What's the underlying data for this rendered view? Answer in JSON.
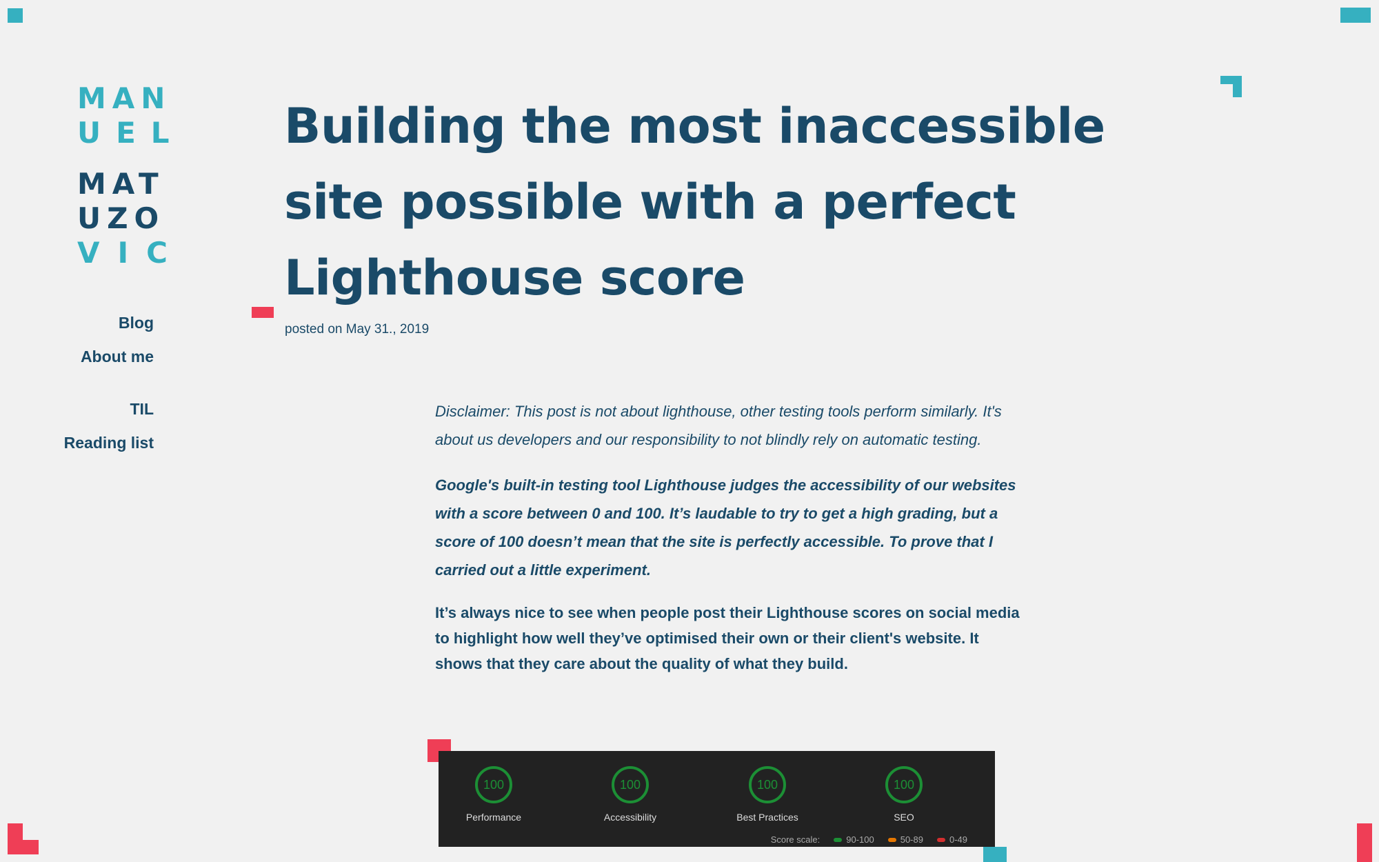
{
  "logo": {
    "lines": [
      "MAN",
      "UEL",
      "MAT",
      "UZO",
      "VIC"
    ]
  },
  "nav": {
    "items": [
      {
        "label": "Blog"
      },
      {
        "label": "About me"
      },
      {
        "label": "TIL"
      },
      {
        "label": "Reading list"
      }
    ]
  },
  "post": {
    "title": "Building the most inaccessible site possible with a perfect Lighthouse score",
    "posted": "posted on May 31., 2019",
    "disclaimer": "Disclaimer: This post is not about lighthouse, other testing tools perform similarly. It's about us developers and our responsibility to not blindly rely on automatic testing.",
    "lead": "Google's built-in testing tool Lighthouse judges the accessibility of our websites with a score between 0 and 100. It’s laudable to try to get a high grading, but a score of 100 doesn’t mean that the site is perfectly accessible. To prove that I carried out a little experiment.",
    "paragraph": "It’s always nice to see when people post their Lighthouse scores on social media to highlight how well they’ve optimised their own or their client's website. It shows that they care about the quality of what they build."
  },
  "lighthouse": {
    "gauges": [
      {
        "score": "100",
        "label": "Performance"
      },
      {
        "score": "100",
        "label": "Accessibility"
      },
      {
        "score": "100",
        "label": "Best Practices"
      },
      {
        "score": "100",
        "label": "SEO"
      }
    ],
    "scale_label": "Score scale:",
    "scale": [
      {
        "range": "90-100",
        "color": "#1c8f35"
      },
      {
        "range": "50-89",
        "color": "#e67700"
      },
      {
        "range": "0-49",
        "color": "#d32f2f"
      }
    ]
  },
  "colors": {
    "background": "#f1f1f1",
    "text": "#1a4a68",
    "accent_teal": "#36b0c0",
    "accent_red": "#ef3e56"
  }
}
